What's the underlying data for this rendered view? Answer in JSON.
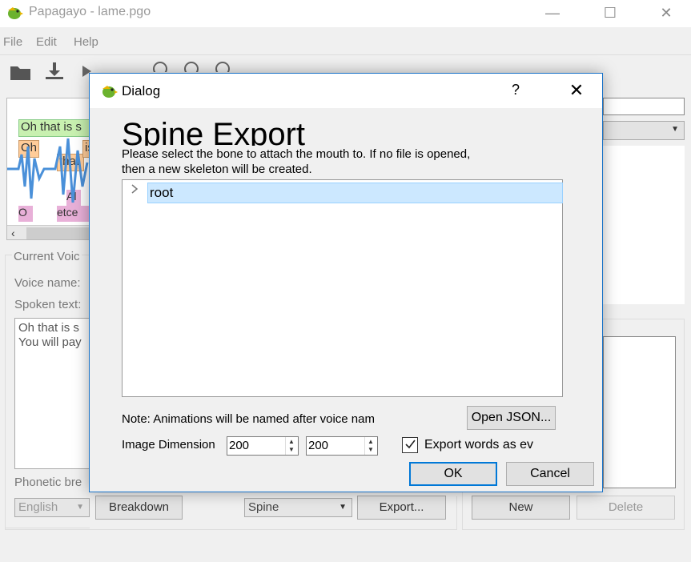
{
  "app": {
    "title": "Papagayo - lame.pgo",
    "menu": [
      "File",
      "Edit",
      "Help"
    ]
  },
  "background": {
    "waveform_words": [
      "Oh that is s",
      "Oh",
      "that",
      "is",
      "Al",
      "etce",
      "O"
    ],
    "current_voice_label": "Current Voic",
    "voice_name_label": "Voice name:",
    "spoken_text_label": "Spoken text:",
    "spoken_text_value": "Oh that is s\nYou will pay",
    "phonetic_label": "Phonetic bre",
    "language_value": "English",
    "breakdown_label": "Breakdown",
    "export_format_value": "Spine",
    "export_label": "Export...",
    "new_label": "New",
    "delete_label": "Delete"
  },
  "dialog": {
    "title": "Dialog",
    "help": "?",
    "close": "✕",
    "heading": "Spine Export",
    "instructions": "Please select the bone to attach the mouth to. If no file is opened, then a new skeleton will be created.",
    "tree_items": [
      {
        "label": "root",
        "selected": true
      }
    ],
    "note": "Note: Animations will be named after voice nam",
    "open_json_label": "Open JSON...",
    "image_dimension_label": "Image Dimension",
    "width_value": "200",
    "height_value": "200",
    "export_words_checked": true,
    "export_words_label": "Export words as ev",
    "ok_label": "OK",
    "cancel_label": "Cancel"
  },
  "colors": {
    "accent": "#0078d7",
    "selection_bg": "#cce8ff",
    "waveform": "#4a90d9",
    "word_green": "#c8f0b0",
    "word_orange": "#ffcc99",
    "phoneme_pink": "#e8b0d8"
  }
}
